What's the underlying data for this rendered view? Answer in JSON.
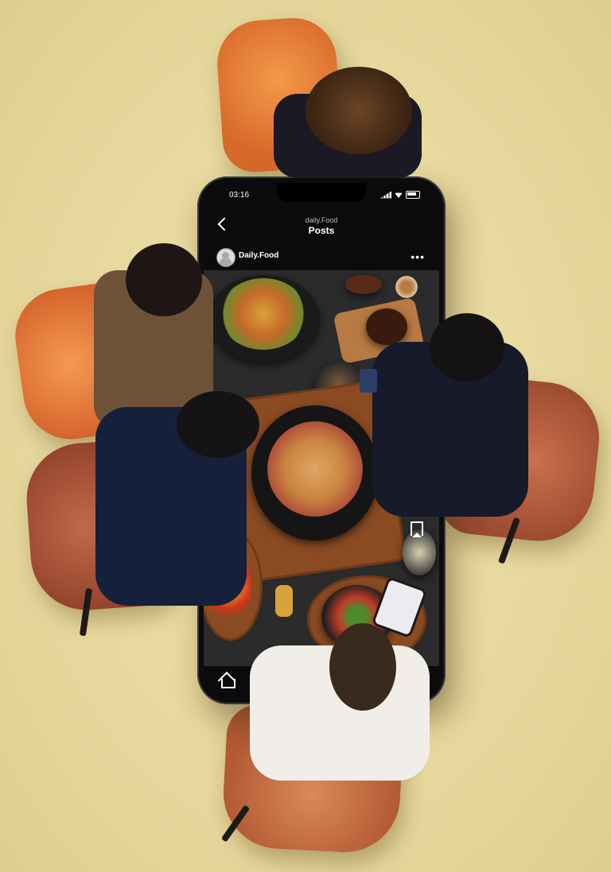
{
  "phone": {
    "status": {
      "time": "03:16"
    },
    "header": {
      "subtitle": "daily.Food",
      "title": "Posts"
    },
    "post": {
      "username": "Daily.Food",
      "more_label": "•••"
    },
    "bottom_nav": {
      "add_label": "+"
    }
  }
}
